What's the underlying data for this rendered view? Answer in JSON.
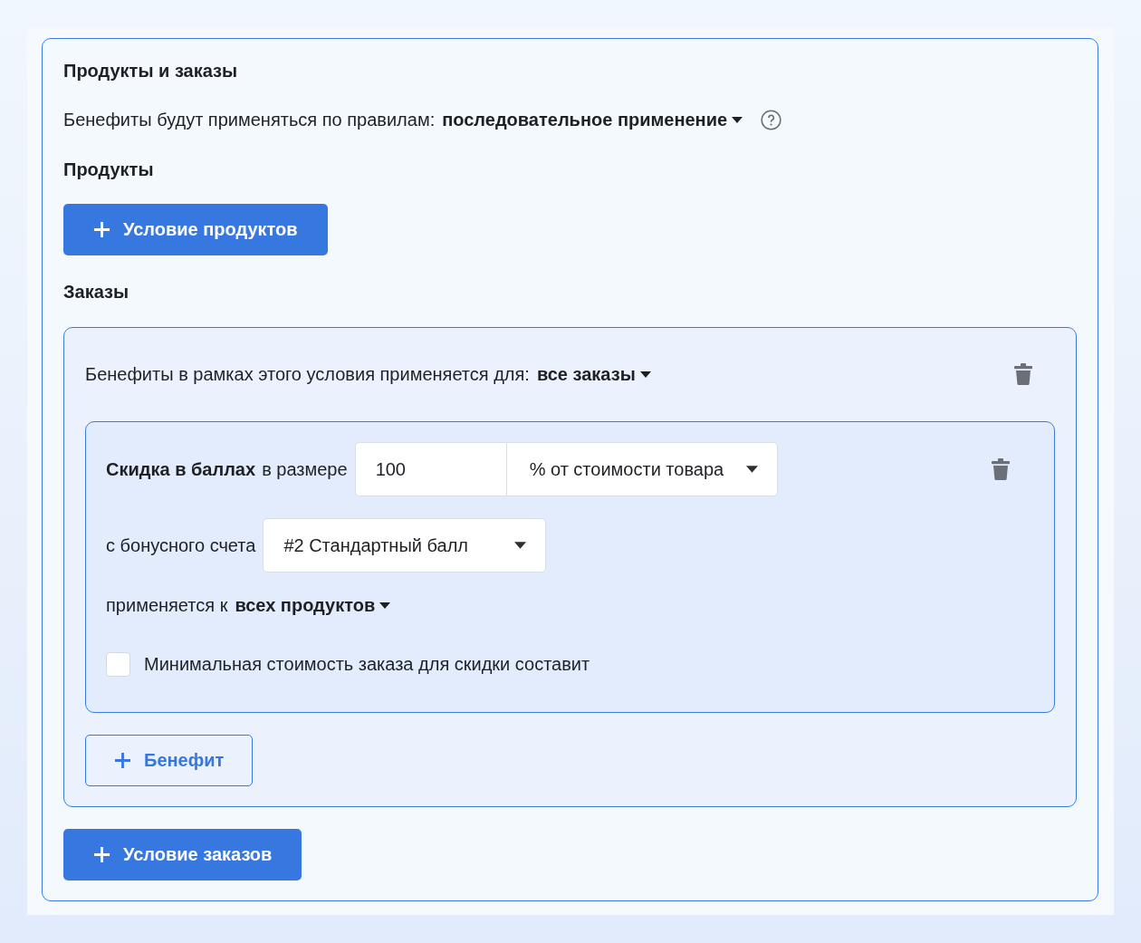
{
  "section": {
    "title": "Продукты и заказы",
    "rule": {
      "label": "Бенефиты будут применяться по правилам:",
      "value": "последовательное применение"
    }
  },
  "products": {
    "heading": "Продукты",
    "add_button": {
      "kind": "primary",
      "label": "Условие продуктов"
    }
  },
  "orders": {
    "heading": "Заказы",
    "conditions": [
      {
        "label": "Бенефиты в рамках этого условия применяется для:",
        "value": "все заказы",
        "benefits": [
          {
            "title": "Скидка в баллах",
            "amount_label": "в размере",
            "amount": "100",
            "unit": "% от стоимости товара",
            "account_label": "с бонусного счета",
            "account": "#2 Стандартный балл",
            "scope_label": "применяется к",
            "scope": "всех продуктов",
            "min_order": {
              "label": "Минимальная стоимость заказа для скидки составит",
              "checked": false
            }
          }
        ],
        "add_button": {
          "kind": "outline",
          "label": "Бенефит"
        }
      }
    ],
    "add_button": {
      "kind": "primary",
      "label": "Условие заказов"
    }
  }
}
